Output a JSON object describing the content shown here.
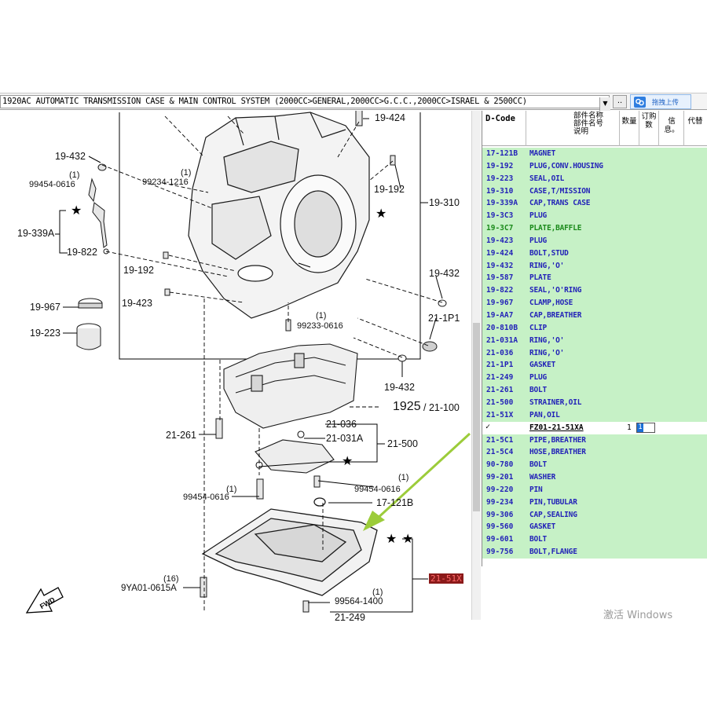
{
  "titlebar": {
    "title": "1920AC  AUTOMATIC TRANSMISSION CASE & MAIN CONTROL SYSTEM (2000CC>GENERAL,2000CC>G.C.C.,2000CC>ISRAEL & 2500CC)",
    "more_label": "..",
    "upload_label": "拖拽上传"
  },
  "diagram": {
    "labels": {
      "l19424": "19-424",
      "l19432a": "19-432",
      "q1a": "(1)",
      "l99454a": "99454-0616",
      "q1b": "(1)",
      "l99234": "99234-1216",
      "l19192a": "19-192",
      "l19310": "19-310",
      "l19339a": "19-339A",
      "l19822": "19-822",
      "l19192b": "19-192",
      "l19432b": "19-432",
      "l19967": "19-967",
      "l19423": "19-423",
      "l211p1": "21-1P1",
      "l19223": "19-223",
      "q1c": "(1)",
      "l99233": "99233-0616",
      "l19432c": "19-432",
      "l1925": "1925",
      "l21100": "/ 21-100",
      "l21036": "21-036",
      "l21261a": "21-261",
      "l21031a": "21-031A",
      "l21500": "21-500",
      "q1d": "(1)",
      "l99454b": "99454-0616",
      "q1e": "(1)",
      "l99454c": "99454-0616",
      "l17121b": "17-121B",
      "l2151x": "21-51X",
      "q16": "(16)",
      "l9ya01": "9YA01-0615A",
      "q1f": "(1)",
      "l99564": "99564-1400",
      "l21249": "21-249"
    },
    "stars": [
      "★",
      "★",
      "★",
      "★",
      "★"
    ],
    "fwd": "FWD"
  },
  "parts_table": {
    "headers": {
      "dcode": "D-Code",
      "name_jp": "部件名称",
      "name_cn": "部件名号",
      "name_desc": "说明",
      "qty": "数量",
      "order_qty": "订购数",
      "info": "信息。",
      "alt": "代替"
    },
    "rows_before": [
      {
        "code": "17-121B",
        "name": "MAGNET"
      },
      {
        "code": "19-192",
        "name": "PLUG,CONV.HOUSING"
      },
      {
        "code": "19-223",
        "name": "SEAL,OIL"
      },
      {
        "code": "19-310",
        "name": "CASE,T/MISSION"
      },
      {
        "code": "19-339A",
        "name": "CAP,TRANS CASE"
      },
      {
        "code": "19-3C3",
        "name": "PLUG"
      },
      {
        "code": "19-3C7",
        "name": "PLATE,BAFFLE"
      },
      {
        "code": "19-423",
        "name": "PLUG"
      },
      {
        "code": "19-424",
        "name": "BOLT,STUD"
      },
      {
        "code": "19-432",
        "name": "RING,'O'"
      },
      {
        "code": "19-587",
        "name": "PLATE"
      },
      {
        "code": "19-822",
        "name": "SEAL,'O'RING"
      },
      {
        "code": "19-967",
        "name": "CLAMP,HOSE"
      },
      {
        "code": "19-AA7",
        "name": "CAP,BREATHER"
      },
      {
        "code": "20-810B",
        "name": "CLIP"
      },
      {
        "code": "21-031A",
        "name": "RING,'O'"
      },
      {
        "code": "21-036",
        "name": "RING,'O'"
      },
      {
        "code": "21-1P1",
        "name": "GASKET"
      },
      {
        "code": "21-249",
        "name": "PLUG"
      },
      {
        "code": "21-261",
        "name": "BOLT"
      },
      {
        "code": "21-500",
        "name": "STRAINER,OIL"
      },
      {
        "code": "21-51X",
        "name": "PAN,OIL"
      }
    ],
    "selected": {
      "check": "✓",
      "part_number": "FZ01-21-51XA",
      "qty": "1",
      "order_qty": "1"
    },
    "rows_after": [
      {
        "code": "21-5C1",
        "name": "PIPE,BREATHER"
      },
      {
        "code": "21-5C4",
        "name": "HOSE,BREATHER"
      },
      {
        "code": "90-780",
        "name": "BOLT"
      },
      {
        "code": "99-201",
        "name": "WASHER"
      },
      {
        "code": "99-220",
        "name": "PIN"
      },
      {
        "code": "99-234",
        "name": "PIN,TUBULAR"
      },
      {
        "code": "99-306",
        "name": "CAP,SEALING"
      },
      {
        "code": "99-560",
        "name": "GASKET"
      },
      {
        "code": "99-601",
        "name": "BOLT"
      },
      {
        "code": "99-756",
        "name": "BOLT,FLANGE"
      }
    ]
  },
  "watermark": "激活 Windows",
  "colors": {
    "row_bg": "#c6f1c6",
    "row_text": "#2323b8",
    "highlight_row_text": "#1a8a1a",
    "callout_arrow": "#9ccc3a",
    "callout_label_bg": "#8b1a1a"
  }
}
